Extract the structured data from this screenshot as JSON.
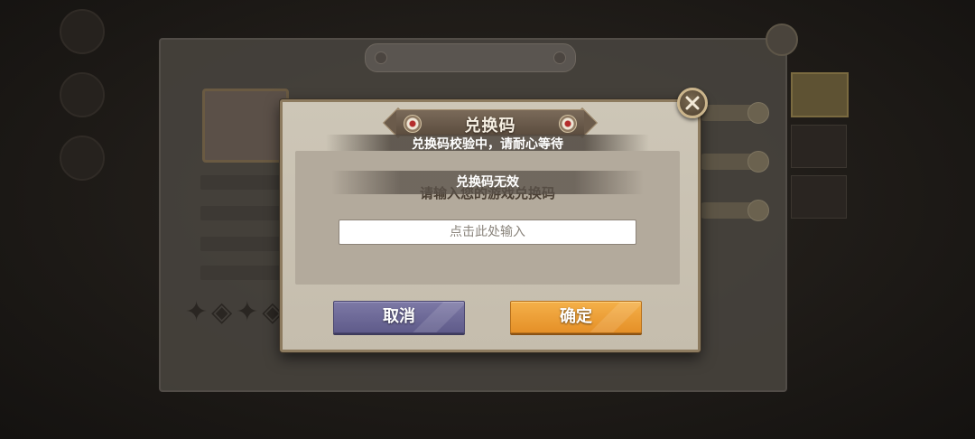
{
  "dialog": {
    "title": "兑换码",
    "status_toast": "兑换码校验中，请耐心等待",
    "invalid_toast": "兑换码无效",
    "prompt": "请输入您的游戏兑换码",
    "input": {
      "value": "",
      "placeholder": "点击此处输入"
    },
    "cancel_label": "取消",
    "confirm_label": "确定",
    "close_icon": "close-icon"
  },
  "colors": {
    "dialog_bg": "#c9c1b1",
    "cancel_button": "#6c68a0",
    "confirm_button": "#eda03a",
    "close_ring": "#cbb58c"
  }
}
